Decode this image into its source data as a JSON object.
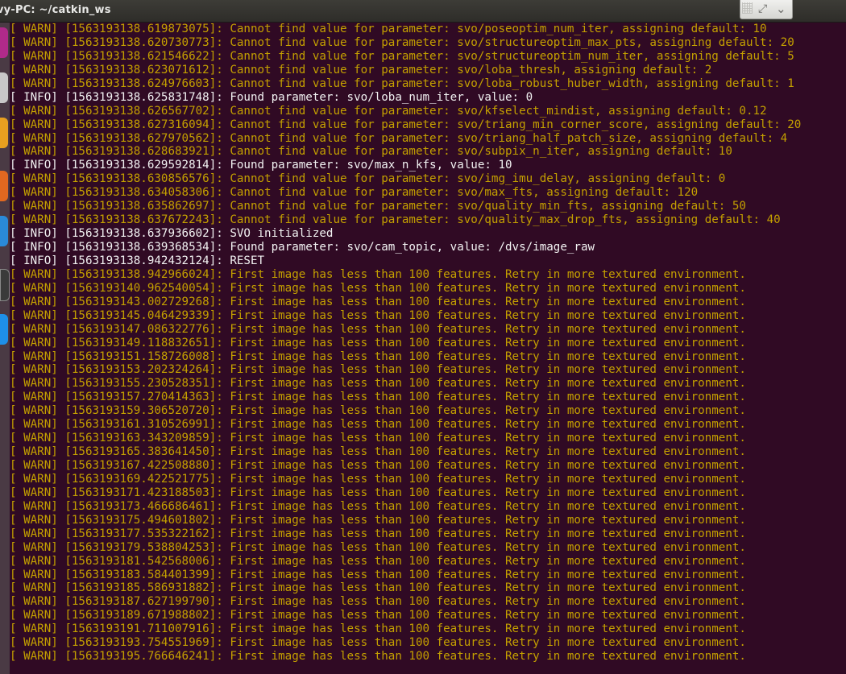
{
  "window": {
    "title": "vy-PC: ~/catkin_ws",
    "resize_icon": "resize-icon",
    "menu_icon": "chevron-down-icon"
  },
  "colors": {
    "warn": "#c4a000",
    "info": "#f2f2f2",
    "background": "#300a24"
  },
  "terminal": {
    "lines": [
      {
        "level": "warn",
        "text": "[ WARN] [1563193138.619873075]: Cannot find value for parameter: svo/poseoptim_num_iter, assigning default: 10"
      },
      {
        "level": "warn",
        "text": "[ WARN] [1563193138.620730773]: Cannot find value for parameter: svo/structureoptim_max_pts, assigning default: 20"
      },
      {
        "level": "warn",
        "text": "[ WARN] [1563193138.621546622]: Cannot find value for parameter: svo/structureoptim_num_iter, assigning default: 5"
      },
      {
        "level": "warn",
        "text": "[ WARN] [1563193138.623071612]: Cannot find value for parameter: svo/loba_thresh, assigning default: 2"
      },
      {
        "level": "warn",
        "text": "[ WARN] [1563193138.624976603]: Cannot find value for parameter: svo/loba_robust_huber_width, assigning default: 1"
      },
      {
        "level": "info",
        "text": "[ INFO] [1563193138.625831748]: Found parameter: svo/loba_num_iter, value: 0"
      },
      {
        "level": "warn",
        "text": "[ WARN] [1563193138.626567702]: Cannot find value for parameter: svo/kfselect_mindist, assigning default: 0.12"
      },
      {
        "level": "warn",
        "text": "[ WARN] [1563193138.627316094]: Cannot find value for parameter: svo/triang_min_corner_score, assigning default: 20"
      },
      {
        "level": "warn",
        "text": "[ WARN] [1563193138.627970562]: Cannot find value for parameter: svo/triang_half_patch_size, assigning default: 4"
      },
      {
        "level": "warn",
        "text": "[ WARN] [1563193138.628683921]: Cannot find value for parameter: svo/subpix_n_iter, assigning default: 10"
      },
      {
        "level": "info",
        "text": "[ INFO] [1563193138.629592814]: Found parameter: svo/max_n_kfs, value: 10"
      },
      {
        "level": "warn",
        "text": "[ WARN] [1563193138.630856576]: Cannot find value for parameter: svo/img_imu_delay, assigning default: 0"
      },
      {
        "level": "warn",
        "text": "[ WARN] [1563193138.634058306]: Cannot find value for parameter: svo/max_fts, assigning default: 120"
      },
      {
        "level": "warn",
        "text": "[ WARN] [1563193138.635862697]: Cannot find value for parameter: svo/quality_min_fts, assigning default: 50"
      },
      {
        "level": "warn",
        "text": "[ WARN] [1563193138.637672243]: Cannot find value for parameter: svo/quality_max_drop_fts, assigning default: 40"
      },
      {
        "level": "info",
        "text": "[ INFO] [1563193138.637936602]: SVO initialized"
      },
      {
        "level": "info",
        "text": "[ INFO] [1563193138.639368534]: Found parameter: svo/cam_topic, value: /dvs/image_raw"
      },
      {
        "level": "info",
        "text": "[ INFO] [1563193138.942432124]: RESET"
      },
      {
        "level": "warn",
        "text": "[ WARN] [1563193138.942966024]: First image has less than 100 features. Retry in more textured environment."
      },
      {
        "level": "warn",
        "text": "[ WARN] [1563193140.962540054]: First image has less than 100 features. Retry in more textured environment."
      },
      {
        "level": "warn",
        "text": "[ WARN] [1563193143.002729268]: First image has less than 100 features. Retry in more textured environment."
      },
      {
        "level": "warn",
        "text": "[ WARN] [1563193145.046429339]: First image has less than 100 features. Retry in more textured environment."
      },
      {
        "level": "warn",
        "text": "[ WARN] [1563193147.086322776]: First image has less than 100 features. Retry in more textured environment."
      },
      {
        "level": "warn",
        "text": "[ WARN] [1563193149.118832651]: First image has less than 100 features. Retry in more textured environment."
      },
      {
        "level": "warn",
        "text": "[ WARN] [1563193151.158726008]: First image has less than 100 features. Retry in more textured environment."
      },
      {
        "level": "warn",
        "text": "[ WARN] [1563193153.202324264]: First image has less than 100 features. Retry in more textured environment."
      },
      {
        "level": "warn",
        "text": "[ WARN] [1563193155.230528351]: First image has less than 100 features. Retry in more textured environment."
      },
      {
        "level": "warn",
        "text": "[ WARN] [1563193157.270414363]: First image has less than 100 features. Retry in more textured environment."
      },
      {
        "level": "warn",
        "text": "[ WARN] [1563193159.306520720]: First image has less than 100 features. Retry in more textured environment."
      },
      {
        "level": "warn",
        "text": "[ WARN] [1563193161.310526991]: First image has less than 100 features. Retry in more textured environment."
      },
      {
        "level": "warn",
        "text": "[ WARN] [1563193163.343209859]: First image has less than 100 features. Retry in more textured environment."
      },
      {
        "level": "warn",
        "text": "[ WARN] [1563193165.383641450]: First image has less than 100 features. Retry in more textured environment."
      },
      {
        "level": "warn",
        "text": "[ WARN] [1563193167.422508880]: First image has less than 100 features. Retry in more textured environment."
      },
      {
        "level": "warn",
        "text": "[ WARN] [1563193169.422521775]: First image has less than 100 features. Retry in more textured environment."
      },
      {
        "level": "warn",
        "text": "[ WARN] [1563193171.423188503]: First image has less than 100 features. Retry in more textured environment."
      },
      {
        "level": "warn",
        "text": "[ WARN] [1563193173.466686461]: First image has less than 100 features. Retry in more textured environment."
      },
      {
        "level": "warn",
        "text": "[ WARN] [1563193175.494601802]: First image has less than 100 features. Retry in more textured environment."
      },
      {
        "level": "warn",
        "text": "[ WARN] [1563193177.535322162]: First image has less than 100 features. Retry in more textured environment."
      },
      {
        "level": "warn",
        "text": "[ WARN] [1563193179.538804253]: First image has less than 100 features. Retry in more textured environment."
      },
      {
        "level": "warn",
        "text": "[ WARN] [1563193181.542568006]: First image has less than 100 features. Retry in more textured environment."
      },
      {
        "level": "warn",
        "text": "[ WARN] [1563193183.584401399]: First image has less than 100 features. Retry in more textured environment."
      },
      {
        "level": "warn",
        "text": "[ WARN] [1563193185.586931882]: First image has less than 100 features. Retry in more textured environment."
      },
      {
        "level": "warn",
        "text": "[ WARN] [1563193187.627199790]: First image has less than 100 features. Retry in more textured environment."
      },
      {
        "level": "warn",
        "text": "[ WARN] [1563193189.671988802]: First image has less than 100 features. Retry in more textured environment."
      },
      {
        "level": "warn",
        "text": "[ WARN] [1563193191.711007916]: First image has less than 100 features. Retry in more textured environment."
      },
      {
        "level": "warn",
        "text": "[ WARN] [1563193193.754551969]: First image has less than 100 features. Retry in more textured environment."
      },
      {
        "level": "warn",
        "text": "[ WARN] [1563193195.766646241]: First image has less than 100 features. Retry in more textured environment."
      }
    ]
  }
}
